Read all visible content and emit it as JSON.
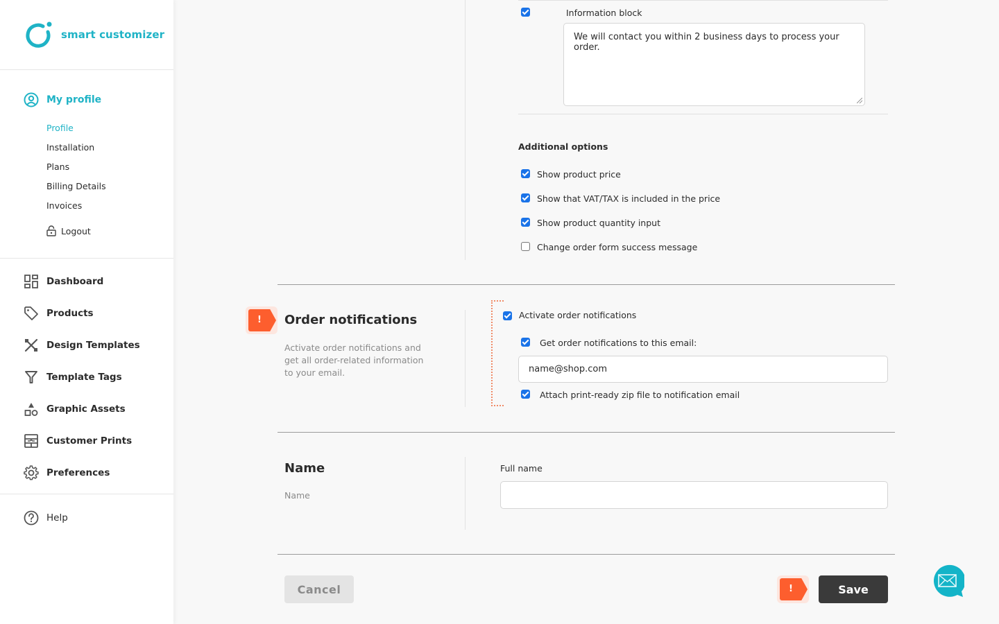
{
  "brand": {
    "name": "smart customizer",
    "accent": "#1fb3c6"
  },
  "profile_menu": {
    "title": "My profile",
    "items": [
      {
        "label": "Profile",
        "active": true
      },
      {
        "label": "Installation",
        "active": false
      },
      {
        "label": "Plans",
        "active": false
      },
      {
        "label": "Billing Details",
        "active": false
      },
      {
        "label": "Invoices",
        "active": false
      }
    ],
    "logout": "Logout"
  },
  "nav": [
    {
      "label": "Dashboard",
      "icon": "dashboard-icon"
    },
    {
      "label": "Products",
      "icon": "tag-icon"
    },
    {
      "label": "Design Templates",
      "icon": "design-tools-icon"
    },
    {
      "label": "Template Tags",
      "icon": "filter-icon"
    },
    {
      "label": "Graphic Assets",
      "icon": "shapes-icon"
    },
    {
      "label": "Customer Prints",
      "icon": "prints-icon"
    },
    {
      "label": "Preferences",
      "icon": "gear-icon"
    }
  ],
  "help": "Help",
  "order_form": {
    "info_block_label": "Information block",
    "info_block_checked": true,
    "info_block_text": "We will contact you within 2 business days to process your order.",
    "additional_title": "Additional options",
    "options": [
      {
        "label": "Show product price",
        "checked": true
      },
      {
        "label": "Show that VAT/TAX is included in the price",
        "checked": true
      },
      {
        "label": "Show product quantity input",
        "checked": true
      },
      {
        "label": "Change order form success message",
        "checked": false
      }
    ]
  },
  "order_notifications": {
    "warning_glyph": "!",
    "title": "Order notifications",
    "description": "Activate order notifications and get all order-related information to your email.",
    "activate_label": "Activate order notifications",
    "activate_checked": true,
    "email_label": "Get order notifications to this email:",
    "email_checked": true,
    "email_value": "name@shop.com",
    "attach_label": "Attach print-ready zip file to notification email",
    "attach_checked": true
  },
  "name_section": {
    "title": "Name",
    "description": "Name",
    "field_label": "Full name",
    "field_value": ""
  },
  "actions": {
    "cancel": "Cancel",
    "save": "Save",
    "warning_glyph": "!"
  },
  "colors": {
    "warning": "#fd5e2e",
    "save_bg": "#3a3a3a",
    "checkbox": "#1a73e8"
  }
}
